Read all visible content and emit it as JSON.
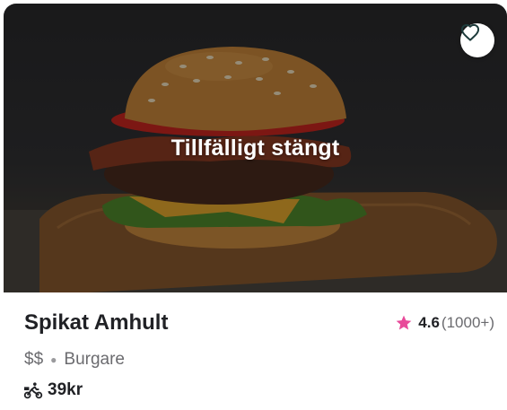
{
  "restaurant": {
    "overlay_text": "Tillfälligt stängt",
    "name": "Spikat Amhult",
    "rating": "4.6",
    "rating_count": "(1000+)",
    "price_level": "$$",
    "category": "Burgare",
    "delivery_fee": "39kr"
  },
  "icons": {
    "favorite": "heart-icon",
    "rating": "star-icon",
    "delivery": "courier-bike-icon"
  },
  "colors": {
    "star": "#e84a9a",
    "text_primary": "#202125",
    "text_secondary": "#6b6b6f"
  }
}
